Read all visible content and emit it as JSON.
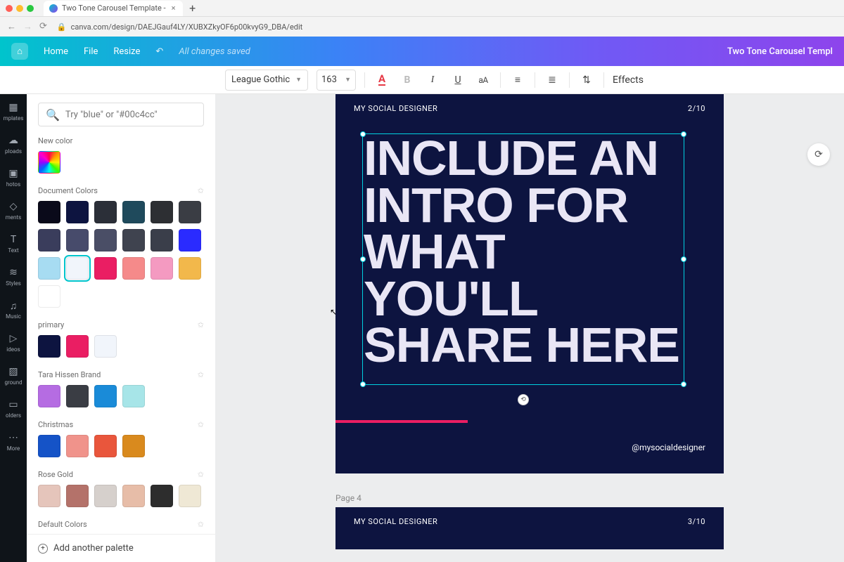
{
  "browser": {
    "tab_title": "Two Tone Carousel Template - ",
    "url_lock": true,
    "url": "canva.com/design/DAEJGauf4LY/XUBXZkyOF6p00kvyG9_DBA/edit"
  },
  "topbar": {
    "home": "Home",
    "file": "File",
    "resize": "Resize",
    "status": "All changes saved",
    "doc_title": "Two Tone Carousel Templ"
  },
  "toolbar": {
    "font_name": "League Gothic",
    "font_size": "163",
    "effects": "Effects"
  },
  "rail": {
    "items": [
      {
        "icon": "▦",
        "label": "mplates"
      },
      {
        "icon": "☁",
        "label": "ploads"
      },
      {
        "icon": "▣",
        "label": "hotos"
      },
      {
        "icon": "◇",
        "label": "ments"
      },
      {
        "icon": "T",
        "label": "Text"
      },
      {
        "icon": "≋",
        "label": "Styles"
      },
      {
        "icon": "♫",
        "label": "Music"
      },
      {
        "icon": "▷",
        "label": "ideos"
      },
      {
        "icon": "▨",
        "label": "ground"
      },
      {
        "icon": "▭",
        "label": "olders"
      },
      {
        "icon": "⋯",
        "label": "More"
      }
    ]
  },
  "panel": {
    "search_placeholder": "Try \"blue\" or \"#00c4cc\"",
    "new_color_label": "New color",
    "sections": [
      {
        "name": "Document Colors",
        "swatches": [
          "#0a0a1a",
          "#0d1440",
          "#2b2f38",
          "#1f4a5c",
          "#2d2f33",
          "#3a3d44",
          "#3a3d5c",
          "#474b6b",
          "#4a4e66",
          "#3f434f",
          "#3a3e4a",
          "#2a2bff",
          "#a7dcf2",
          "#f1f5fb",
          "#ea1e63",
          "#f58a8a",
          "#f49ac1",
          "#f2b84b",
          "#ffffff"
        ],
        "selected_index": 13
      },
      {
        "name": "primary",
        "swatches": [
          "#0d1440",
          "#ea1e63",
          "#f1f5fb"
        ]
      },
      {
        "name": "Tara Hissen Brand",
        "swatches": [
          "#b56ce2",
          "#3a3d44",
          "#1a8bd8",
          "#a7e5e8"
        ]
      },
      {
        "name": "Christmas",
        "swatches": [
          "#1553c7",
          "#f0938b",
          "#e9563c",
          "#d98a1e"
        ]
      },
      {
        "name": "Rose Gold",
        "swatches": [
          "#e5c5bb",
          "#b4726a",
          "#d6d0cc",
          "#e7bda8",
          "#2d2d2d",
          "#efe8d5"
        ]
      },
      {
        "name": "Default Colors",
        "swatches": [
          "#000000",
          "#545454",
          "#777777",
          "#a0a0a0",
          "#cfcfcf",
          "#ffffff"
        ]
      }
    ],
    "footer": "Add another palette"
  },
  "canvas": {
    "page3": {
      "brand": "MY SOCIAL DESIGNER",
      "counter": "2/10",
      "big_text": "INCLUDE AN INTRO FOR WHAT YOU'LL SHARE HERE",
      "handle": "@mysocialdesigner"
    },
    "page4_label": "Page 4",
    "page4": {
      "brand": "MY SOCIAL DESIGNER",
      "counter": "3/10"
    }
  }
}
